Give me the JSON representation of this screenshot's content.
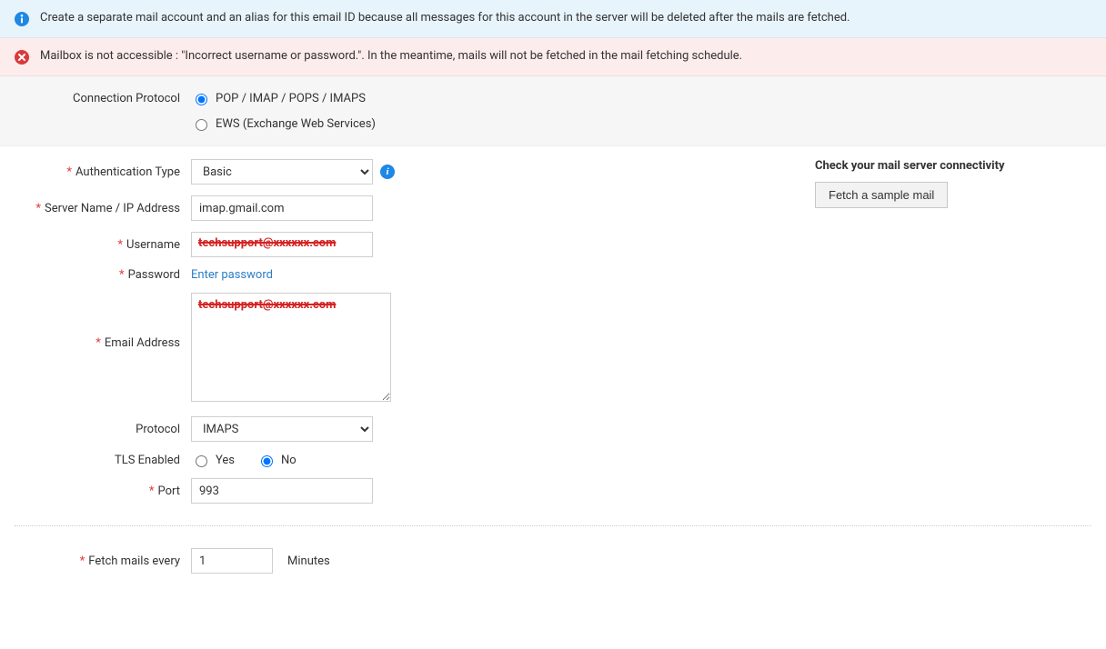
{
  "banners": {
    "info": "Create a separate mail account and an alias for this email ID because all messages for this account in the server will be deleted after the mails are fetched.",
    "error": "Mailbox is not accessible : \"Incorrect username or password.\". In the meantime, mails will not be fetched in the mail fetching schedule."
  },
  "labels": {
    "connection_protocol": "Connection Protocol",
    "auth_type": "Authentication Type",
    "server_name": "Server Name / IP Address",
    "username": "Username",
    "password": "Password",
    "email_address": "Email Address",
    "protocol": "Protocol",
    "tls_enabled": "TLS Enabled",
    "port": "Port",
    "fetch_every": "Fetch mails every",
    "minutes": "Minutes"
  },
  "connection_protocol": {
    "option_pop": "POP / IMAP / POPS / IMAPS",
    "option_ews": "EWS (Exchange Web Services)",
    "selected": "pop"
  },
  "auth_type": {
    "value": "Basic"
  },
  "server_name": "imap.gmail.com",
  "username_redacted": "techsupport@xxxxxx.com",
  "password_link": "Enter password",
  "email_address_redacted": "techsupport@xxxxxx.com",
  "protocol": {
    "value": "IMAPS"
  },
  "tls": {
    "yes": "Yes",
    "no": "No",
    "selected": "no"
  },
  "port": "993",
  "fetch_interval": "1",
  "right": {
    "title": "Check your mail server connectivity",
    "button": "Fetch a sample mail"
  }
}
